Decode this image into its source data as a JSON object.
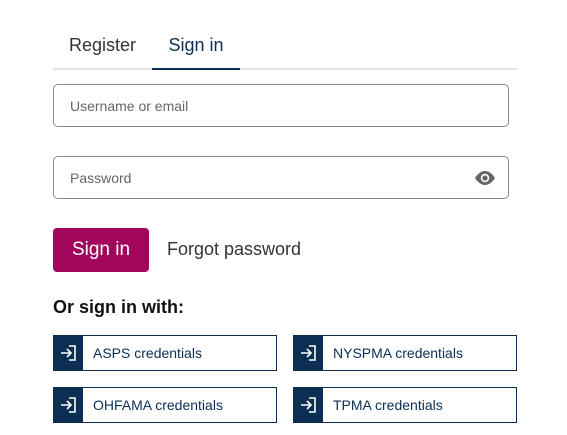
{
  "tabs": {
    "register": "Register",
    "signin": "Sign in"
  },
  "form": {
    "username_placeholder": "Username or email",
    "username_value": "",
    "password_placeholder": "Password",
    "password_value": "",
    "password_toggle_icon": "eye-icon"
  },
  "actions": {
    "signin_label": "Sign in",
    "forgot_label": "Forgot password"
  },
  "sso": {
    "heading": "Or sign in with:",
    "icon": "sign-in-icon",
    "items": [
      {
        "label": "ASPS credentials"
      },
      {
        "label": "NYSPMA credentials"
      },
      {
        "label": "OHFAMA credentials"
      },
      {
        "label": "TPMA credentials"
      }
    ]
  },
  "colors": {
    "primary_button": "#a2065c",
    "navy": "#0c2e52"
  }
}
